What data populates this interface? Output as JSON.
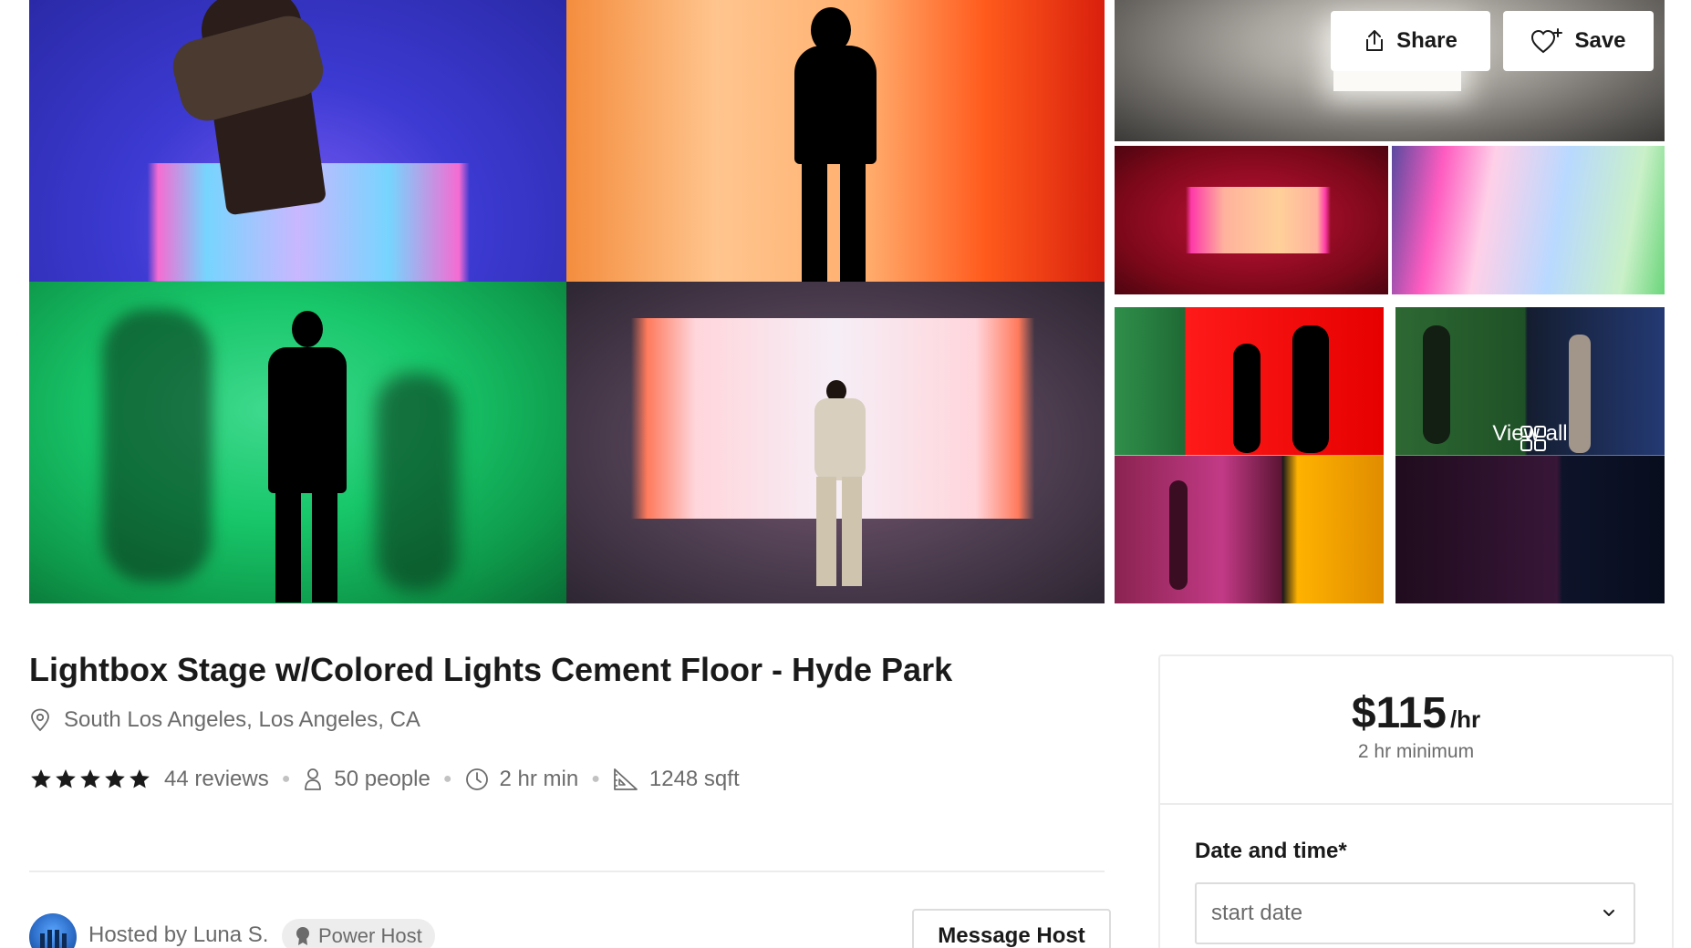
{
  "gallery": {
    "share_label": "Share",
    "save_label": "Save",
    "view_all_label": "View all",
    "photos": [
      "photo-1",
      "photo-2",
      "photo-3",
      "photo-4",
      "photo-5",
      "photo-6",
      "photo-7",
      "photo-8",
      "photo-9"
    ]
  },
  "listing": {
    "title": "Lightbox Stage w/Colored Lights Cement Floor - Hyde Park",
    "location": "South Los Angeles, Los Angeles, CA",
    "rating_stars": 5,
    "reviews": "44 reviews",
    "capacity": "50 people",
    "min_hours": "2 hr min",
    "size": "1248 sqft"
  },
  "host": {
    "hosted_by": "Hosted by Luna S.",
    "badge": "Power Host",
    "message_label": "Message Host"
  },
  "booking": {
    "price": "$115",
    "unit": "/hr",
    "minimum": "2 hr minimum",
    "date_label": "Date and time*",
    "date_placeholder": "start date"
  },
  "colors": {
    "text": "#1a1a1a",
    "muted": "#6b6b6b",
    "border": "#ececec"
  }
}
